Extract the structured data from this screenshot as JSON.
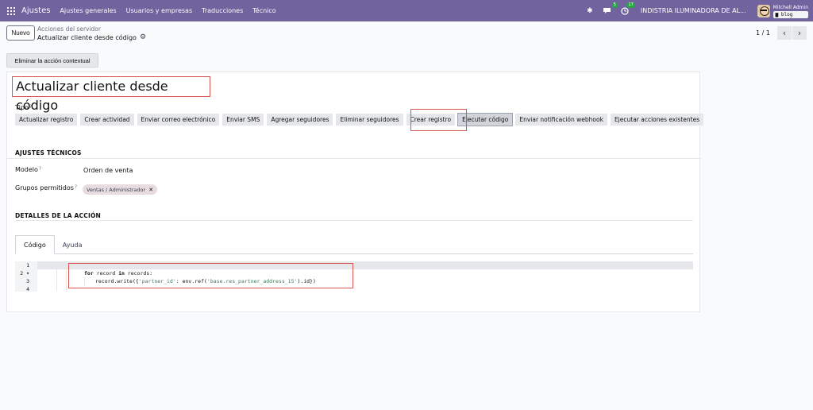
{
  "navbar": {
    "app_name": "Ajustes",
    "menu": [
      "Ajustes generales",
      "Usuarios y empresas",
      "Traducciones",
      "Técnico"
    ],
    "messages_badge": "5",
    "activity_badge": "17",
    "company": "INDISTRIA ILUMINADORA DE AL...",
    "user_name": "Mitchell Admin",
    "database": "blog"
  },
  "control_panel": {
    "new_button": "Nuevo",
    "breadcrumb_parent": "Acciones del servidor",
    "breadcrumb_current": "Actualizar cliente desde código",
    "pager_value": "1 / 1",
    "pager_prev": "‹",
    "pager_next": "›",
    "contextual_button": "Eliminar la acción contextual"
  },
  "form": {
    "title": "Actualizar cliente desde código",
    "type_label": "Tipo",
    "help_mark": "?",
    "types": [
      "Actualizar registro",
      "Crear actividad",
      "Enviar correo electrónico",
      "Enviar SMS",
      "Agregar seguidores",
      "Eliminar seguidores",
      "Crear registro",
      "Ejecutar código",
      "Enviar notificación webhook",
      "Ejecutar acciones existentes"
    ],
    "selected_type": "Ejecutar código",
    "tech_section": "AJUSTES TÉCNICOS",
    "model_label": "Modelo",
    "model_value": "Orden de venta",
    "groups_label": "Grupos permitidos",
    "group_tag": "Ventas / Administrador",
    "details_section": "DETALLES DE LA ACCIÓN",
    "tabs": [
      "Código",
      "Ayuda"
    ]
  },
  "code_editor": {
    "line_numbers": [
      "1",
      "2 ▾",
      "3",
      "4"
    ],
    "line2_kw1": "for",
    "line2_mid": " record ",
    "line2_kw2": "in",
    "line2_end": " records:",
    "line3_start": "record.write({",
    "line3_str1": "'partner_id'",
    "line3_mid": ": env.ref(",
    "line3_str2": "'base.res_partner_address_15'",
    "line3_end": ").id})"
  },
  "colors": {
    "navbar": "#71639e",
    "highlight": "#d9534f",
    "tag": "#e8dce0"
  }
}
